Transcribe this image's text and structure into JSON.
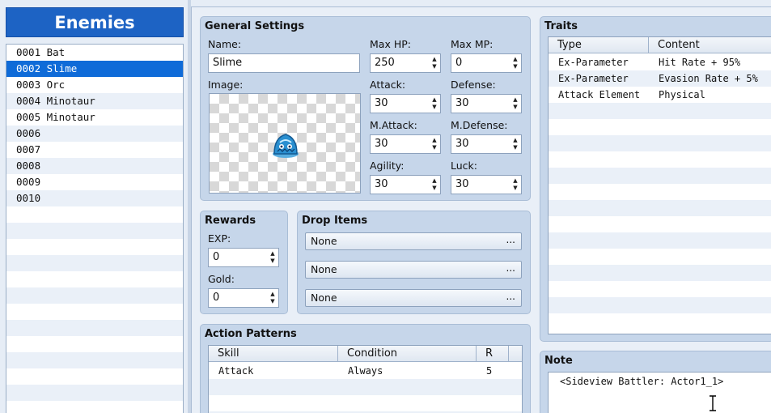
{
  "sidebar": {
    "title": "Enemies",
    "items": [
      "0001 Bat",
      "0002 Slime",
      "0003 Orc",
      "0004 Minotaur",
      "0005 Minotaur",
      "0006",
      "0007",
      "0008",
      "0009",
      "0010"
    ],
    "selected_index": 1
  },
  "general": {
    "title": "General Settings",
    "name_label": "Name:",
    "name_value": "Slime",
    "image_label": "Image:",
    "image_icon": "slime-sprite",
    "stats": {
      "max_hp": {
        "label": "Max HP:",
        "value": "250"
      },
      "max_mp": {
        "label": "Max MP:",
        "value": "0"
      },
      "attack": {
        "label": "Attack:",
        "value": "30"
      },
      "defense": {
        "label": "Defense:",
        "value": "30"
      },
      "m_attack": {
        "label": "M.Attack:",
        "value": "30"
      },
      "m_defense": {
        "label": "M.Defense:",
        "value": "30"
      },
      "agility": {
        "label": "Agility:",
        "value": "30"
      },
      "luck": {
        "label": "Luck:",
        "value": "30"
      }
    }
  },
  "rewards": {
    "title": "Rewards",
    "exp_label": "EXP:",
    "exp_value": "0",
    "gold_label": "Gold:",
    "gold_value": "0"
  },
  "drops": {
    "title": "Drop Items",
    "items": [
      "None",
      "None",
      "None"
    ],
    "button_glyph": "..."
  },
  "actions": {
    "title": "Action Patterns",
    "columns": [
      "Skill",
      "Condition",
      "R"
    ],
    "rows": [
      {
        "skill": "Attack",
        "condition": "Always",
        "r": "5"
      }
    ]
  },
  "traits": {
    "title": "Traits",
    "columns": [
      "Type",
      "Content"
    ],
    "rows": [
      {
        "type": "Ex-Parameter",
        "content": "Hit Rate + 95%"
      },
      {
        "type": "Ex-Parameter",
        "content": "Evasion Rate + 5%"
      },
      {
        "type": "Attack Element",
        "content": "Physical"
      }
    ]
  },
  "note": {
    "title": "Note",
    "text": "<Sideview Battler: Actor1_1>"
  },
  "colors": {
    "accent": "#1d63c4",
    "selection": "#0f6bd8",
    "group_bg": "#c6d6ea"
  }
}
